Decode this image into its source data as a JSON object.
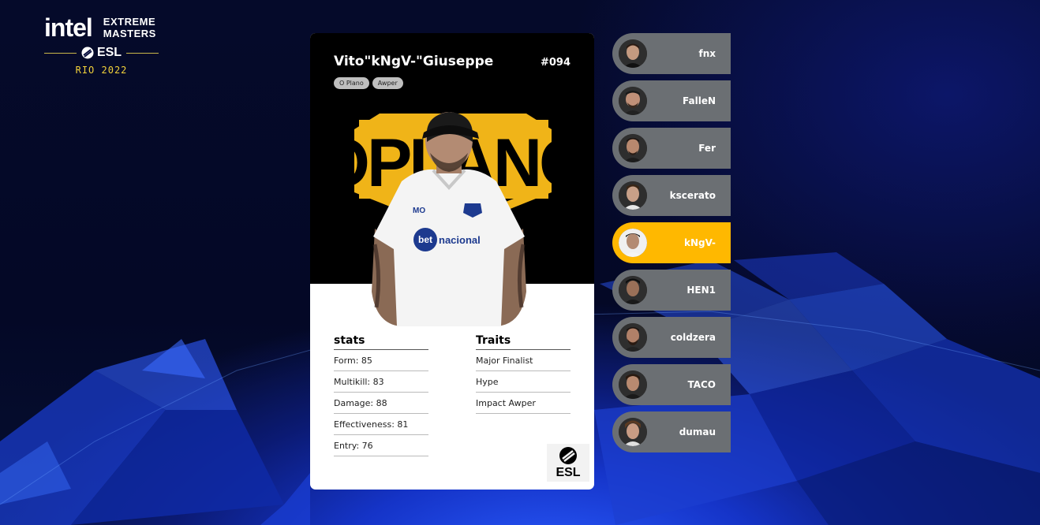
{
  "logo": {
    "brand": "intel",
    "event_line1": "EXTREME",
    "event_line2": "MASTERS",
    "organizer": "ESL",
    "edition": "RIO 2022"
  },
  "card": {
    "player_name": "Vito\"kNgV-\"Giuseppe",
    "number": "#094",
    "tags": [
      "O Plano",
      "Awper"
    ],
    "team_logo_text": "OPLANO",
    "stats_heading": "stats",
    "stats": [
      {
        "label": "Form",
        "value": 85,
        "text": "Form: 85"
      },
      {
        "label": "Multikill",
        "value": 83,
        "text": "Multikill: 83"
      },
      {
        "label": "Damage",
        "value": 88,
        "text": "Damage: 88"
      },
      {
        "label": "Effectiveness",
        "value": 81,
        "text": "Effectiveness: 81"
      },
      {
        "label": "Entry",
        "value": 76,
        "text": "Entry: 76"
      }
    ],
    "traits_heading": "Traits",
    "traits": [
      "Major Finalist",
      "Hype",
      "Impact Awper"
    ],
    "badge_text": "ESL"
  },
  "players": [
    {
      "name": "fnx",
      "active": false
    },
    {
      "name": "FalleN",
      "active": false
    },
    {
      "name": "Fer",
      "active": false
    },
    {
      "name": "kscerato",
      "active": false
    },
    {
      "name": "kNgV-",
      "active": true
    },
    {
      "name": "HEN1",
      "active": false
    },
    {
      "name": "coldzera",
      "active": false
    },
    {
      "name": "TACO",
      "active": false
    },
    {
      "name": "dumau",
      "active": false
    }
  ],
  "colors": {
    "accent": "#ffb800",
    "player_item": "#6b6f73",
    "logo_gold": "#f2d23a",
    "team_gold": "#f0b418"
  }
}
